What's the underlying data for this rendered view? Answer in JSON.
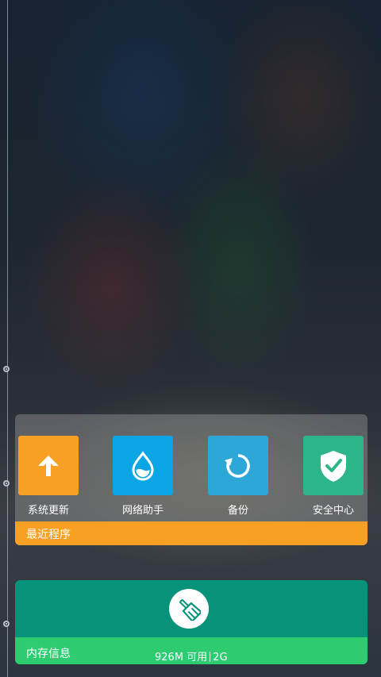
{
  "recent_apps": {
    "footer_label": "最近程序",
    "apps": [
      {
        "label": "系统更新",
        "icon": "arrow-up-icon",
        "color": "#f8a023"
      },
      {
        "label": "网络助手",
        "icon": "water-drop-icon",
        "color": "#0aa5e4"
      },
      {
        "label": "备份",
        "icon": "refresh-icon",
        "color": "#2da7d8"
      },
      {
        "label": "安全中心",
        "icon": "shield-check-icon",
        "color": "#2db489"
      }
    ]
  },
  "memory": {
    "footer_label": "内存信息",
    "available": "926M 可用",
    "total": "2G",
    "clean_icon": "broom-icon",
    "accent_color": "#079379",
    "footer_color": "#2ecc71"
  }
}
